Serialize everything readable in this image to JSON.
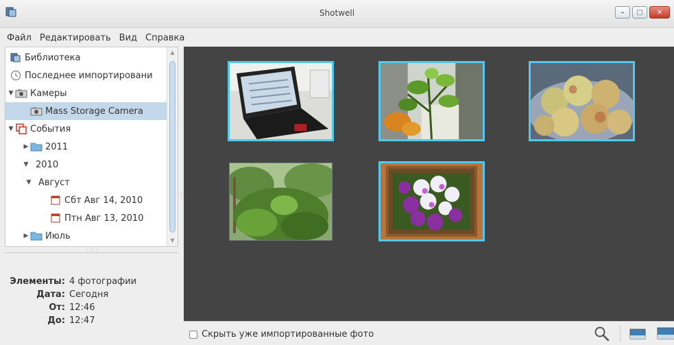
{
  "window": {
    "title": "Shotwell"
  },
  "menu": [
    "Файл",
    "Редактировать",
    "Вид",
    "Справка"
  ],
  "sidebar": {
    "items": [
      {
        "label": "Библиотека",
        "icon": "library-icon",
        "level": 0,
        "expander": ""
      },
      {
        "label": "Последнее импортировани",
        "icon": "clock-icon",
        "level": 0,
        "expander": ""
      },
      {
        "label": "Камеры",
        "icon": "camera-icon",
        "level": 0,
        "expander": "▼"
      },
      {
        "label": "Mass Storage Camera",
        "icon": "camera-icon",
        "level": 1,
        "expander": "",
        "selected": true
      },
      {
        "label": "События",
        "icon": "events-icon",
        "level": 0,
        "expander": "▼"
      },
      {
        "label": "2011",
        "icon": "folder-icon",
        "level": 1,
        "expander": "▶"
      },
      {
        "label": "2010",
        "icon": "",
        "level": 1,
        "expander": "▼"
      },
      {
        "label": "Август",
        "icon": "",
        "level": 2,
        "expander": "▼"
      },
      {
        "label": "Сбт Авг 14, 2010",
        "icon": "calendar-icon",
        "level": 3,
        "expander": ""
      },
      {
        "label": "Птн Авг 13, 2010",
        "icon": "calendar-icon",
        "level": 3,
        "expander": ""
      },
      {
        "label": "Июль",
        "icon": "folder-icon",
        "level": 1,
        "expander": "▶"
      }
    ]
  },
  "properties": {
    "items_label": "Элементы:",
    "items_value": "4 фотографии",
    "date_label": "Дата:",
    "date_value": "Сегодня",
    "from_label": "От:",
    "from_value": "12:46",
    "to_label": "До:",
    "to_value": "12:47"
  },
  "photos": [
    {
      "name": "photo-laptop",
      "subject": "laptop",
      "selected": true
    },
    {
      "name": "photo-plant",
      "subject": "plant",
      "selected": true
    },
    {
      "name": "photo-apples",
      "subject": "apples",
      "selected": true
    },
    {
      "name": "photo-garden",
      "subject": "garden",
      "selected": false
    },
    {
      "name": "photo-orchids",
      "subject": "orchids",
      "selected": true
    }
  ],
  "bottombar": {
    "hide_imported_label": "Скрыть уже импортированные фото",
    "hide_imported_checked": false
  },
  "colors": {
    "selection": "#54c8ec",
    "canvas": "#444444",
    "tree_selected": "#c3d8ea"
  }
}
